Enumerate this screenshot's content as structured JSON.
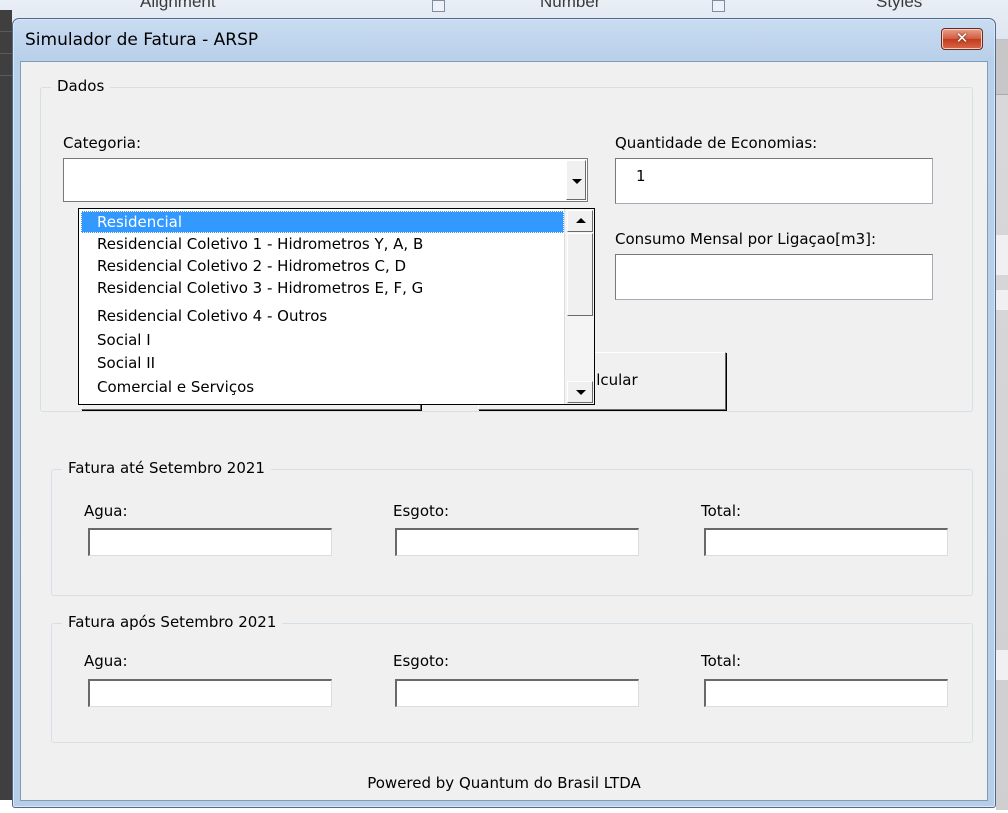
{
  "background": {
    "ribbon_groups": [
      "Alignment",
      "Number",
      "Styles"
    ]
  },
  "window": {
    "title": "Simulador de Fatura - ARSP",
    "close_glyph": "✕"
  },
  "dados": {
    "legend": "Dados",
    "categoria_label": "Categoria:",
    "categoria_value": "",
    "economias_label": "Quantidade de Economias:",
    "economias_value": "1",
    "consumo_label": "Consumo Mensal por Ligaçao[m3]:",
    "consumo_value": "",
    "calcular_label": "Calcular",
    "calcular_visible_text": "alcular"
  },
  "dropdown": {
    "items": [
      "Residencial",
      "Residencial Coletivo 1 - Hidrometros Y, A, B",
      "Residencial Coletivo 2 - Hidrometros C, D",
      "Residencial Coletivo 3 - Hidrometros E, F, G",
      "Residencial Coletivo 4 - Outros",
      "Social I",
      "Social II",
      "Comercial e Serviços"
    ],
    "selected_index": 0
  },
  "fatura_ate": {
    "legend": "Fatura até Setembro 2021",
    "agua_label": "Agua:",
    "esgoto_label": "Esgoto:",
    "total_label": "Total:"
  },
  "fatura_apos": {
    "legend": "Fatura após Setembro 2021",
    "agua_label": "Agua:",
    "esgoto_label": "Esgoto:",
    "total_label": "Total:"
  },
  "footer": {
    "text": "Powered by Quantum do Brasil LTDA"
  },
  "colors": {
    "selection": "#3399ff",
    "dialog_face": "#f0f0f0",
    "title_bar": "#b9d0ea",
    "close_button": "#cf5a3c"
  }
}
